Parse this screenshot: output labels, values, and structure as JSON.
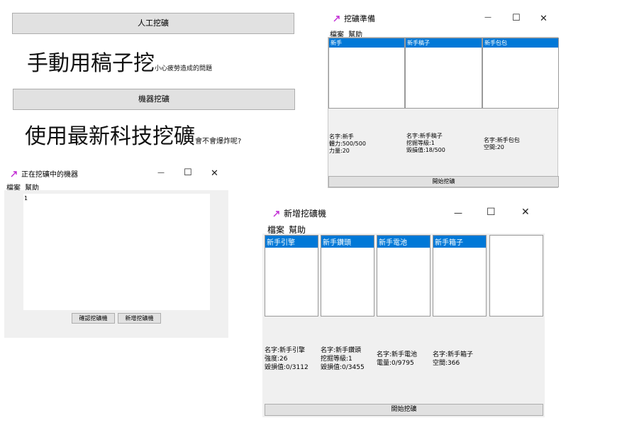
{
  "manual": {
    "button": "人工挖礦",
    "heading": "手動用稿子挖",
    "sub": "小心疲勞造成的問題"
  },
  "machine": {
    "button": "機器挖礦",
    "heading": "使用最新科技挖礦",
    "sub": "會不會爆炸呢?"
  },
  "prep_window": {
    "title": "挖礦準備",
    "menu": [
      "檔案",
      "幫助"
    ],
    "columns": [
      {
        "header": "新手",
        "info": "名字:新手\n體力:500/500\n力量:20"
      },
      {
        "header": "新手稿子",
        "info": "名字:新手稿子\n挖掘等級:1\n毀損值:18/500"
      },
      {
        "header": "新手包包",
        "info": "名字:新手包包\n空間:20"
      }
    ],
    "start_button": "開始挖礦"
  },
  "running_window": {
    "title": "正在挖礦中的機器",
    "menu": [
      "檔案",
      "幫助"
    ],
    "list_item": "1",
    "confirm_button": "確認挖礦機",
    "add_button": "新增挖礦機"
  },
  "add_window": {
    "title": "新增挖礦機",
    "menu": [
      "檔案",
      "幫助"
    ],
    "columns": [
      {
        "header": "新手引擎",
        "info": "名字:新手引擎\n強度:26\n毀損值:0/3112"
      },
      {
        "header": "新手鑽頭",
        "info": "名字:新手鑽頭\n挖掘等級:1\n毀損值:0/3455"
      },
      {
        "header": "新手電池",
        "info": "名字:新手電池\n電量:0/9795"
      },
      {
        "header": "新手箱子",
        "info": "名字:新手箱子\n空間:366"
      }
    ],
    "start_button": "開始挖礦"
  },
  "window_controls": {
    "minimize": "—",
    "maximize": "☐",
    "close": "✕"
  },
  "colors": {
    "accent": "#0078d7",
    "icon": "#c026d3"
  }
}
